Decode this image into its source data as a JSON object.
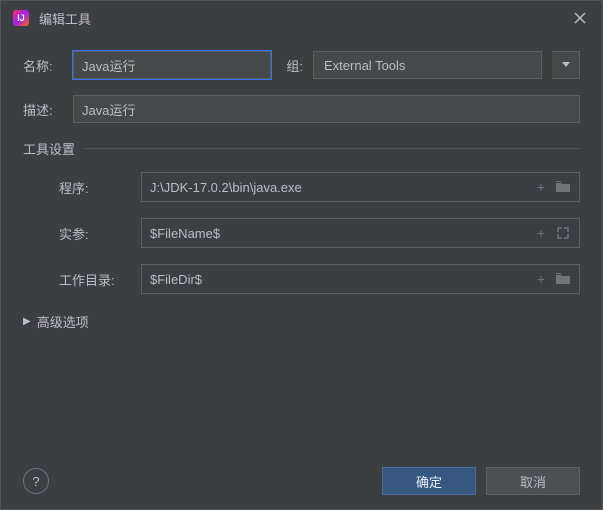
{
  "titlebar": {
    "title": "编辑工具"
  },
  "labels": {
    "name": "名称:",
    "group": "组:",
    "description": "描述:",
    "section": "工具设置",
    "program": "程序:",
    "arguments": "实参:",
    "workingDir": "工作目录:",
    "advanced": "高级选项"
  },
  "values": {
    "name": "Java运行",
    "group": "External Tools",
    "description": "Java运行",
    "program": "J:\\JDK-17.0.2\\bin\\java.exe",
    "arguments": "$FileName$",
    "workingDir": "$FileDir$"
  },
  "buttons": {
    "ok": "确定",
    "cancel": "取消",
    "help": "?"
  }
}
